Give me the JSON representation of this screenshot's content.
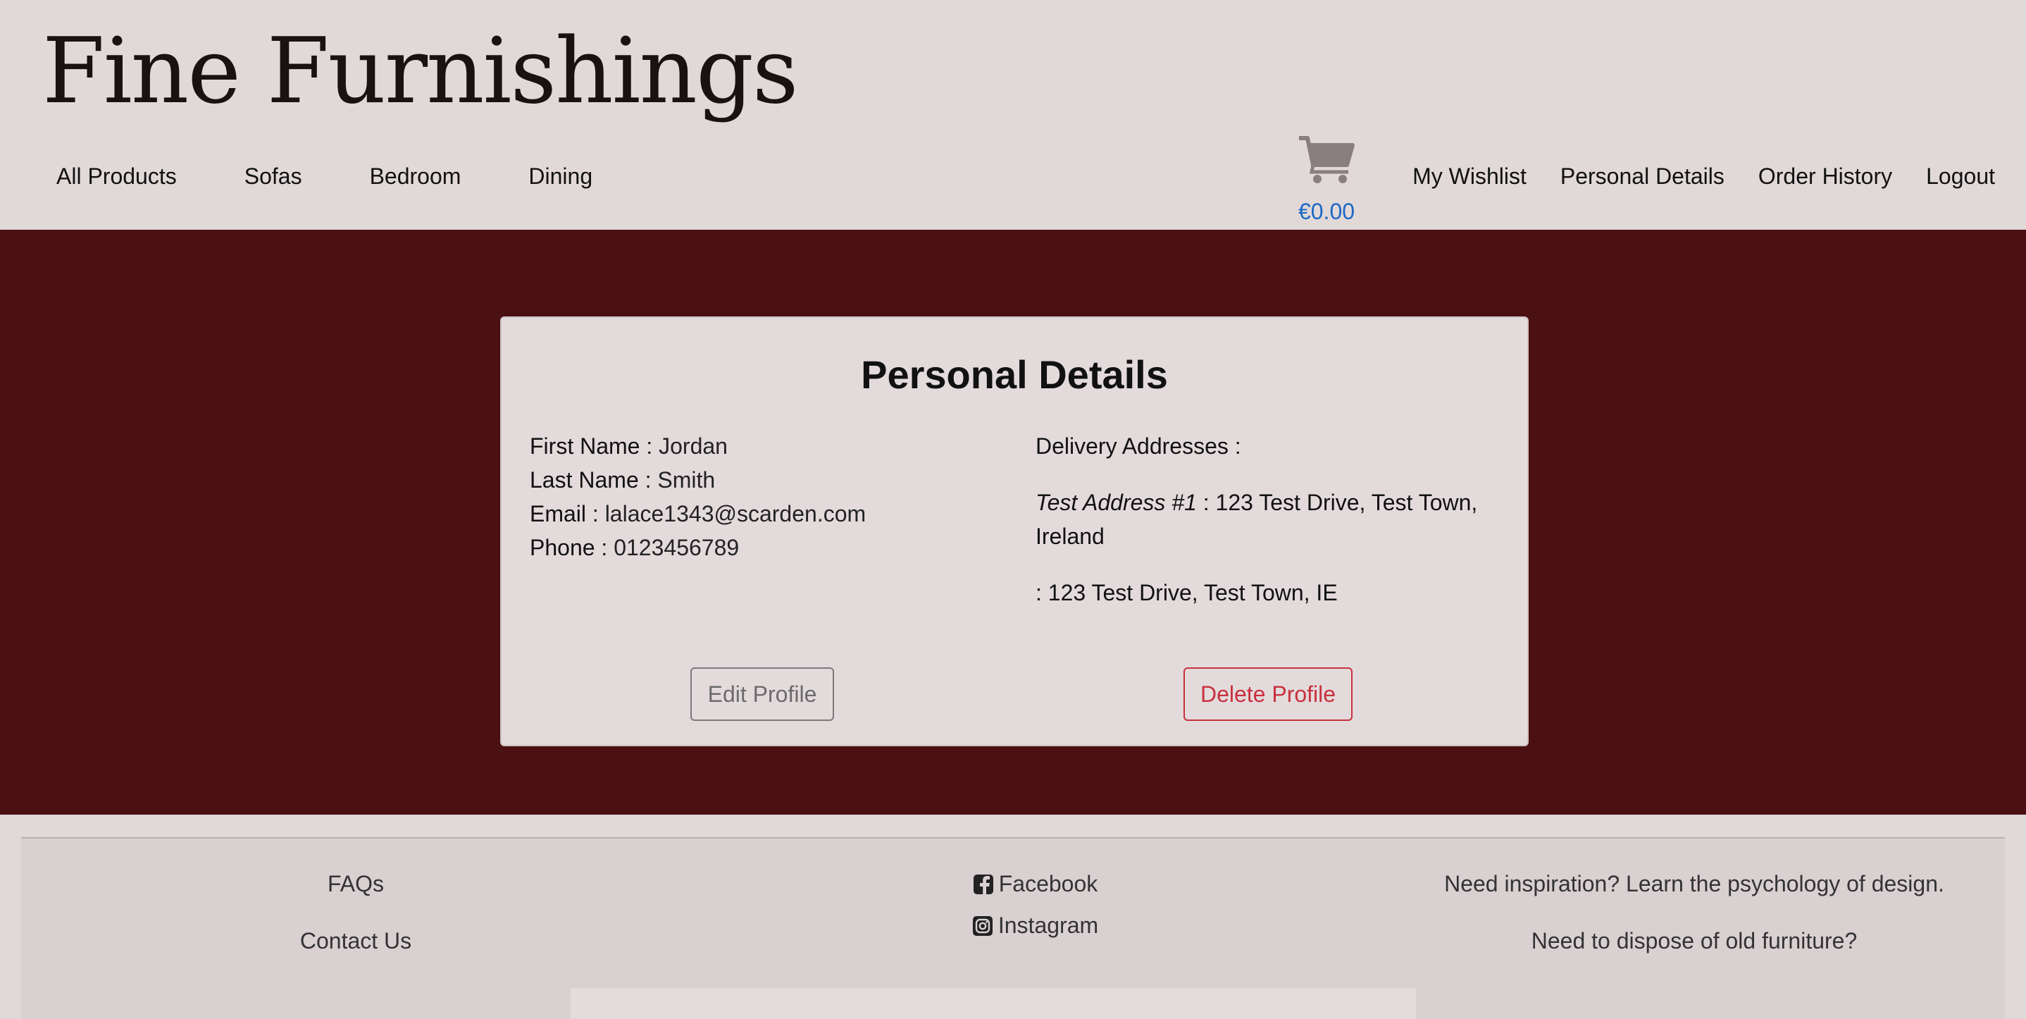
{
  "header": {
    "logo": "Fine Furnishings",
    "nav_left": [
      {
        "label": "All Products"
      },
      {
        "label": "Sofas"
      },
      {
        "label": "Bedroom"
      },
      {
        "label": "Dining"
      }
    ],
    "cart": {
      "icon": "shopping-cart-icon",
      "total": "€0.00",
      "total_color": "#1d68c4"
    },
    "nav_right": [
      {
        "label": "My Wishlist"
      },
      {
        "label": "Personal Details"
      },
      {
        "label": "Order History"
      },
      {
        "label": "Logout"
      }
    ]
  },
  "colors": {
    "header_bg": "#e1d8d8",
    "band_bg": "#4a1012",
    "card_bg": "#e3dadb",
    "danger": "#c8313e"
  },
  "details": {
    "title": "Personal Details",
    "first_name_label": "First Name :",
    "first_name": "Jordan",
    "last_name_label": "Last Name :",
    "last_name": "Smith",
    "email_label": "Email :",
    "email": "lalace1343@scarden.com",
    "phone_label": "Phone :",
    "phone": "0123456789",
    "addresses_label": "Delivery Addresses :",
    "addresses": [
      {
        "name": "Test Address #1",
        "text": " : 123 Test Drive, Test Town, Ireland"
      },
      {
        "name": "",
        "text": ": 123 Test Drive, Test Town, IE"
      }
    ],
    "edit_button": "Edit Profile",
    "delete_button": "Delete Profile"
  },
  "footer": {
    "left_links": [
      {
        "label": "FAQs"
      },
      {
        "label": "Contact Us"
      }
    ],
    "social_links": [
      {
        "label": "Facebook",
        "icon": "facebook-icon"
      },
      {
        "label": "Instagram",
        "icon": "instagram-icon"
      }
    ],
    "right_links": [
      {
        "label": "Need inspiration? Learn the psychology of design."
      },
      {
        "label": "Need to dispose of old furniture?"
      }
    ]
  }
}
